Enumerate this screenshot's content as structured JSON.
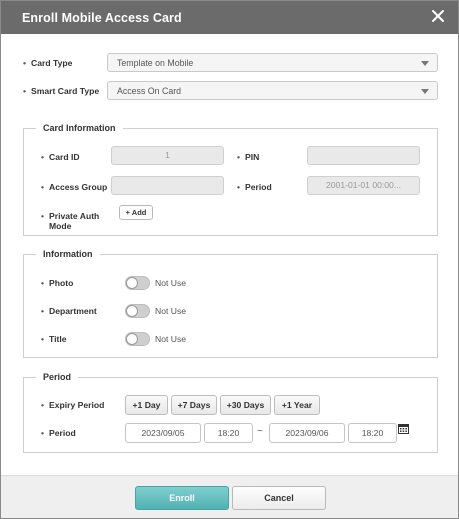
{
  "dialog": {
    "title": "Enroll Mobile Access Card"
  },
  "card_type": {
    "label": "Card Type",
    "value": "Template on Mobile"
  },
  "smart_card_type": {
    "label": "Smart Card Type",
    "value": "Access On Card"
  },
  "card_information": {
    "legend": "Card Information",
    "card_id_label": "Card ID",
    "card_id_value": "1",
    "pin_label": "PIN",
    "pin_value": "",
    "access_group_label": "Access Group",
    "access_group_value": "",
    "period_label": "Period",
    "period_value": "2001-01-01 00:00...",
    "private_auth_label_line1": "Private Auth",
    "private_auth_label_line2": "Mode",
    "add_button": "+ Add"
  },
  "information": {
    "legend": "Information",
    "photo_label": "Photo",
    "photo_state": "Not Use",
    "department_label": "Department",
    "department_state": "Not Use",
    "title_label": "Title",
    "title_state": "Not Use"
  },
  "period": {
    "legend": "Period",
    "expiry_label": "Expiry Period",
    "btn_1day": "+1 Day",
    "btn_7days": "+7 Days",
    "btn_30days": "+30 Days",
    "btn_1year": "+1 Year",
    "period_label": "Period",
    "start_date": "2023/09/05",
    "start_time": "18:20",
    "separator": "~",
    "end_date": "2023/09/06",
    "end_time": "18:20"
  },
  "footer": {
    "enroll": "Enroll",
    "cancel": "Cancel"
  }
}
